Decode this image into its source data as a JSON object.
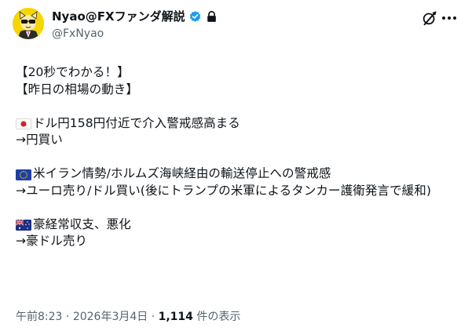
{
  "author": {
    "display_name": "Nyao@FXファンダ解説",
    "handle": "@FxNyao"
  },
  "icons": {
    "avatar": "cartoon-character-avatar",
    "verified": "verified-badge-icon",
    "protected": "lock-icon",
    "grok": "grok-icon",
    "more": "more-icon"
  },
  "post": {
    "line1": "【20秒でわかる！】",
    "line2": "【昨日の相場の動き】",
    "jp_flag": "🇯🇵",
    "line3": "ドル円158円付近で介入警戒感高まる",
    "line4": "→円買い",
    "eu_flag": "🇪🇺",
    "line5": "米イラン情勢/ホルムズ海峡経由の輸送停止への警戒感",
    "line6": "→ユーロ売り/ドル買い(後にトランプの米軍によるタンカー護衛発言で緩和)",
    "au_flag": "🇦🇺",
    "line7": "豪経常収支、悪化",
    "line8": "→豪ドル売り"
  },
  "meta": {
    "time": "午前8:23",
    "separator1": " · ",
    "date": "2026年3月4日",
    "separator2": " · ",
    "views_count": "1,114",
    "views_label": " 件の表示"
  },
  "colors": {
    "text": "#0f1419",
    "secondary": "#536471",
    "verified": "#1d9bf0",
    "avatar_bg": "#f6d600"
  }
}
